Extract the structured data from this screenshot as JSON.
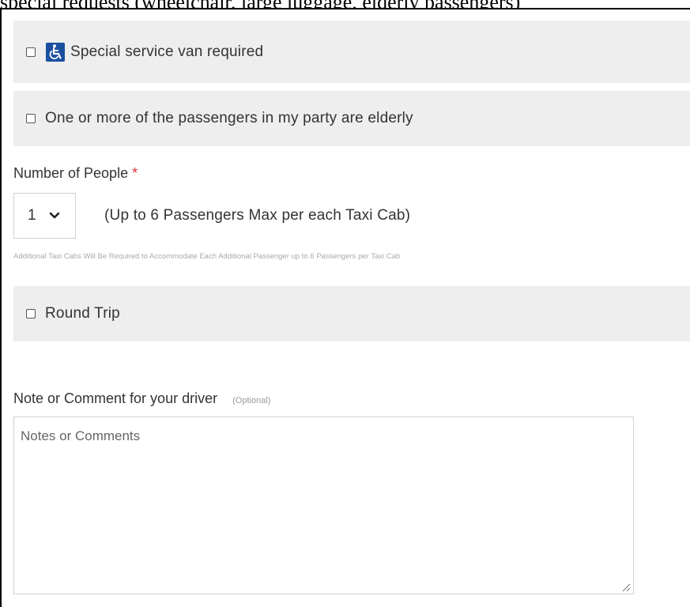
{
  "top_clip_text": "special requests (wheelchair, large luggage, elderly passengers)",
  "options": {
    "van": {
      "label": "Special service van required",
      "icon": "wheelchair-icon",
      "icon_color": "#1a4fa0"
    },
    "elderly": {
      "label": "One or more of the passengers in my party are elderly"
    },
    "round_trip": {
      "label": "Round Trip"
    }
  },
  "people": {
    "label": "Number of People",
    "required_mark": "*",
    "selected": "1",
    "note": "(Up to 6 Passengers Max per each Taxi Cab)",
    "fine_print": "Additional Taxi Cabs Will Be Required to Accommodate Each Additional Passenger up to 6 Passengers per Taxi Cab"
  },
  "notes": {
    "label": "Note or Comment for your driver",
    "optional_tag": "(Optional)",
    "placeholder": "Notes or Comments",
    "value": ""
  },
  "colors": {
    "required": "#e03030",
    "option_bg": "#eeeeee"
  }
}
